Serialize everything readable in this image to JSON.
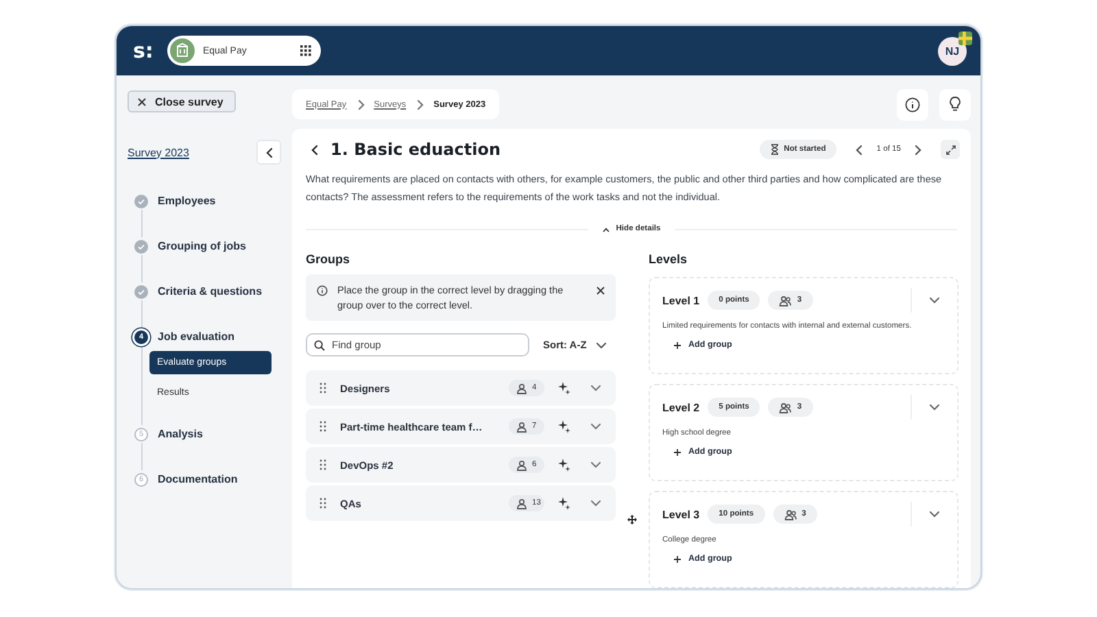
{
  "header": {
    "logo": "s:",
    "app": "Equal Pay",
    "avatar": "NJ"
  },
  "close_button": "Close survey",
  "breadcrumb": [
    {
      "label": "Equal Pay",
      "current": false
    },
    {
      "label": "Surveys",
      "current": false
    },
    {
      "label": "Survey 2023",
      "current": true
    }
  ],
  "sidebar": {
    "survey": "Survey 2023",
    "steps": [
      {
        "label": "Employees",
        "kind": "done"
      },
      {
        "label": "Grouping of jobs",
        "kind": "done"
      },
      {
        "label": "Criteria & questions",
        "kind": "done"
      },
      {
        "label": "Job evaluation",
        "kind": "current",
        "number": "4",
        "children": [
          {
            "label": "Evaluate groups",
            "selected": true
          },
          {
            "label": "Results",
            "selected": false
          }
        ]
      },
      {
        "label": "Analysis",
        "kind": "pending",
        "number": "5"
      },
      {
        "label": "Documentation",
        "kind": "pending",
        "number": "6"
      }
    ]
  },
  "question": {
    "title": "1. Basic eduaction",
    "status": "Not started",
    "pager": "1 of 15",
    "description": "What requirements are placed on contacts with others, for example customers, the public and other third parties and how complicated are these contacts? The assessment refers to the requirements of the work tasks and not the individual.",
    "toggle": "Hide details"
  },
  "groups": {
    "heading": "Groups",
    "hint": "Place the group in the correct level by dragging the group over to the correct level.",
    "search": {
      "placeholder": "Find group"
    },
    "sort": "Sort: A-Z",
    "items": [
      {
        "name": "Designers",
        "count": "4"
      },
      {
        "name": "Part-time healthcare team f…",
        "count": "7"
      },
      {
        "name": "DevOps #2",
        "count": "6"
      },
      {
        "name": "QAs",
        "count": "13"
      }
    ]
  },
  "levels": {
    "heading": "Levels",
    "items": [
      {
        "title": "Level 1",
        "points": "0 points",
        "count": "3",
        "description": "Limited requirements for contacts with internal and external customers.",
        "action": "Add group"
      },
      {
        "title": "Level 2",
        "points": "5 points",
        "count": "3",
        "description": "High school degree",
        "action": "Add group"
      },
      {
        "title": "Level 3",
        "points": "10 points",
        "count": "3",
        "description": "College degree",
        "action": "Add group"
      }
    ]
  }
}
